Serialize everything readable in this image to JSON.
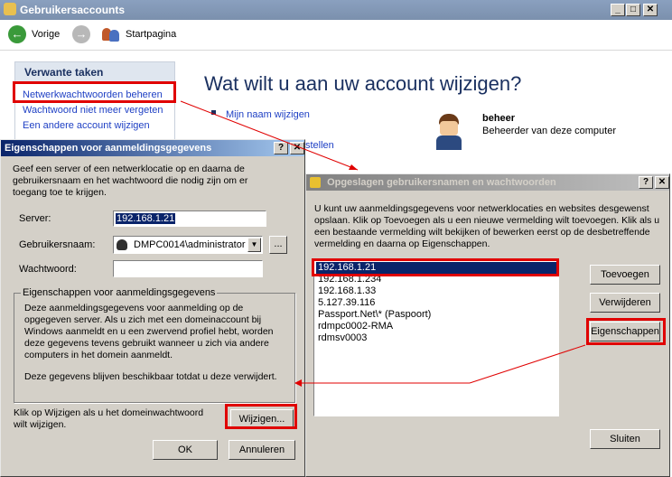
{
  "main": {
    "title": "Gebruikersaccounts",
    "nav": {
      "back": "Vorige",
      "home": "Startpagina"
    },
    "tasks_header": "Verwante taken",
    "tasks": [
      "Netwerkwachtwoorden beheren",
      "Wachtwoord niet meer vergeten",
      "Een andere account wijzigen"
    ],
    "heading": "Wat wilt u aan uw account wijzigen?",
    "links": [
      "Mijn naam wijzigen",
      "stellen"
    ],
    "user": {
      "name": "beheer",
      "role": "Beheerder van deze computer"
    }
  },
  "props": {
    "title": "Eigenschappen voor aanmeldingsgegevens",
    "intro": "Geef een server of een netwerklocatie op en daarna de gebruikersnaam en het wachtwoord die nodig zijn om er toegang toe te krijgen.",
    "server_label": "Server:",
    "server_value": "192.168.1.21",
    "user_label": "Gebruikersnaam:",
    "user_value": "DMPC0014\\administrator",
    "browse_label": "...",
    "password_label": "Wachtwoord:",
    "group_title": "Eigenschappen voor aanmeldingsgegevens",
    "group_text1": "Deze aanmeldingsgegevens voor aanmelding op de opgegeven server. Als u zich met een domeinaccount bij Windows aanmeldt en u een zwervend profiel hebt, worden deze gegevens tevens gebruikt wanneer u zich via andere computers in het domein aanmeldt.",
    "group_text2": "Deze gegevens blijven beschikbaar totdat u deze verwijdert.",
    "change_text": "Klik op Wijzigen als u het domeinwachtwoord wilt wijzigen.",
    "change_btn": "Wijzigen...",
    "ok_btn": "OK",
    "cancel_btn": "Annuleren"
  },
  "saved": {
    "title": "Opgeslagen gebruikersnamen en wachtwoorden",
    "intro": "U kunt uw aanmeldingsgegevens voor netwerklocaties en websites desgewenst opslaan. Klik op Toevoegen als u een nieuwe vermelding wilt toevoegen. Klik als u een bestaande vermelding wilt bekijken of bewerken eerst op de desbetreffende vermelding en daarna op Eigenschappen.",
    "entries": [
      "192.168.1.21",
      "192.168.1.234",
      "192.168.1.33",
      "5.127.39.116",
      "Passport.Net\\* (Paspoort)",
      "rdmpc0002-RMA",
      "rdmsv0003"
    ],
    "add_btn": "Toevoegen",
    "remove_btn": "Verwijderen",
    "props_btn": "Eigenschappen",
    "close_btn": "Sluiten"
  },
  "colors": {
    "highlight": "#e00000",
    "selection": "#0a246a",
    "link": "#1f40c4",
    "heading": "#1a3060"
  }
}
